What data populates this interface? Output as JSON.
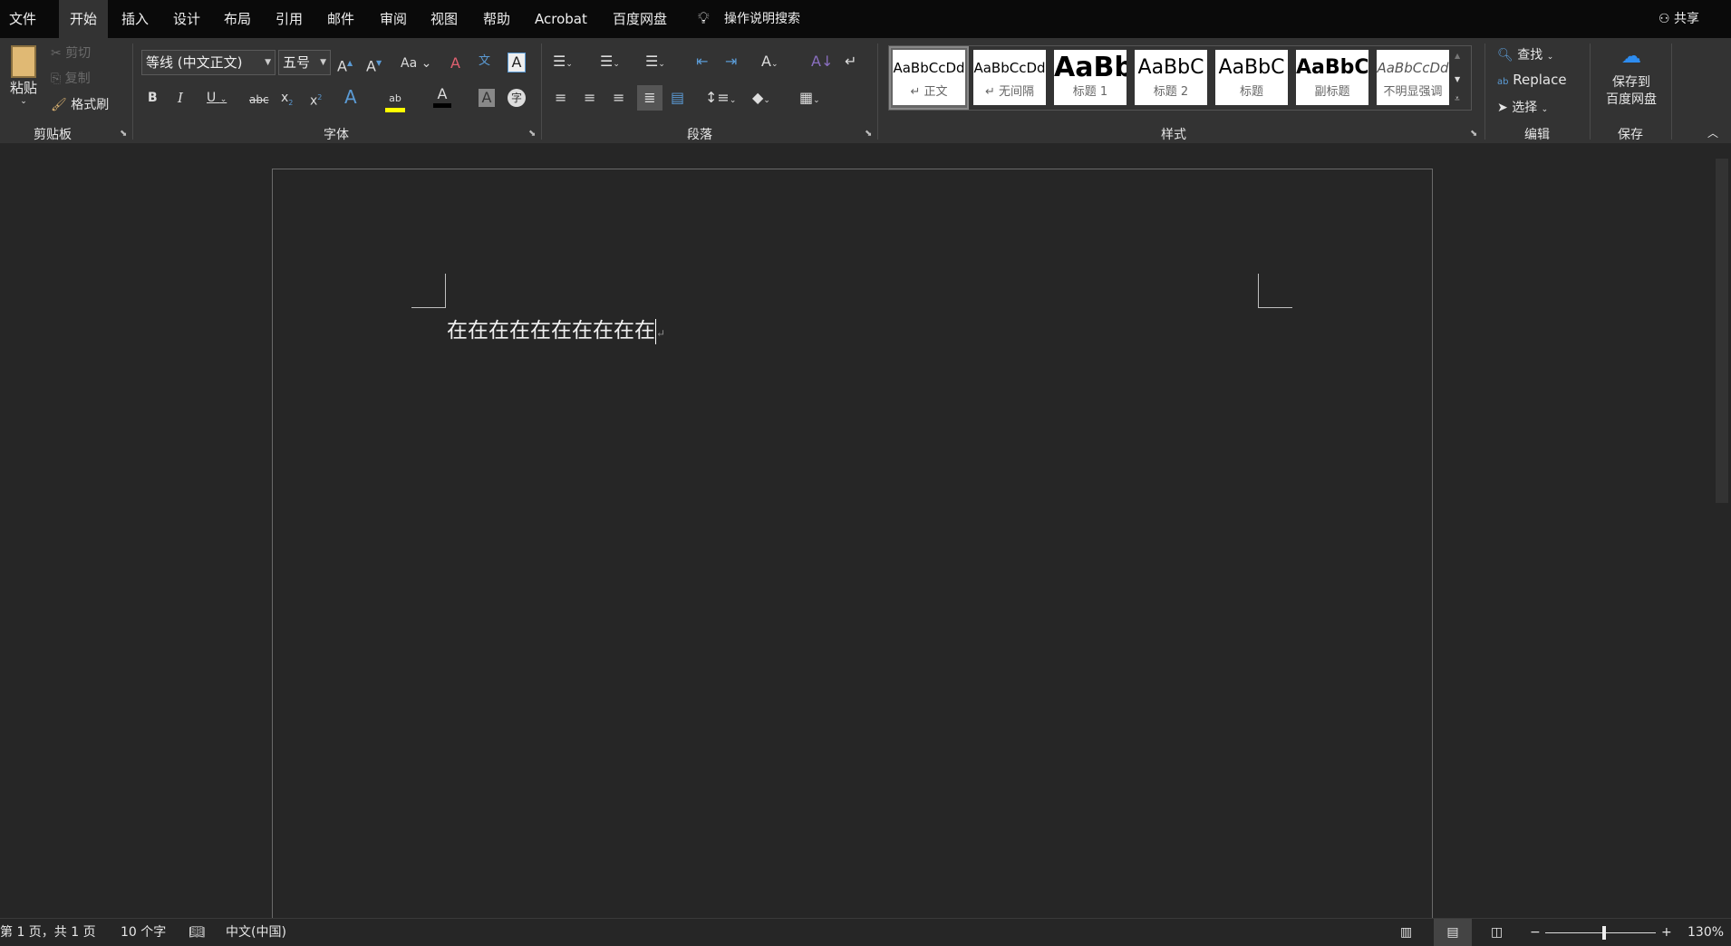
{
  "tabs": [
    "文件",
    "开始",
    "插入",
    "设计",
    "布局",
    "引用",
    "邮件",
    "审阅",
    "视图",
    "帮助",
    "Acrobat",
    "百度网盘"
  ],
  "active_tab": "开始",
  "tell_me": "操作说明搜索",
  "share": "共享",
  "clipboard": {
    "paste": "粘贴",
    "cut": "剪切",
    "copy": "复制",
    "format_painter": "格式刷",
    "label": "剪贴板"
  },
  "font": {
    "name": "等线 (中文正文)",
    "size": "五号",
    "label": "字体",
    "highlight_color": "#ffff00",
    "font_color": "#000000"
  },
  "paragraph": {
    "label": "段落"
  },
  "styles": {
    "label": "样式",
    "items": [
      {
        "preview": "AaBbCcDd",
        "name": "↵ 正文",
        "selected": true
      },
      {
        "preview": "AaBbCcDd",
        "name": "↵ 无间隔"
      },
      {
        "preview": "AaBb",
        "name": "标题 1"
      },
      {
        "preview": "AaBbC",
        "name": "标题 2"
      },
      {
        "preview": "AaBbC",
        "name": "标题"
      },
      {
        "preview": "AaBbC",
        "name": "副标题"
      },
      {
        "preview": "AaBbCcDd",
        "name": "不明显强调"
      }
    ]
  },
  "editing": {
    "find": "查找",
    "replace": "Replace",
    "select": "选择",
    "label": "编辑"
  },
  "save": {
    "button": "保存到\n百度网盘",
    "line1": "保存到",
    "line2": "百度网盘",
    "label": "保存"
  },
  "document": {
    "text": "在在在在在在在在在在"
  },
  "status": {
    "page": "第 1 页，共 1 页",
    "words": "10 个字",
    "language": "中文(中国)",
    "zoom": "130%",
    "zoom_percent": 130
  }
}
